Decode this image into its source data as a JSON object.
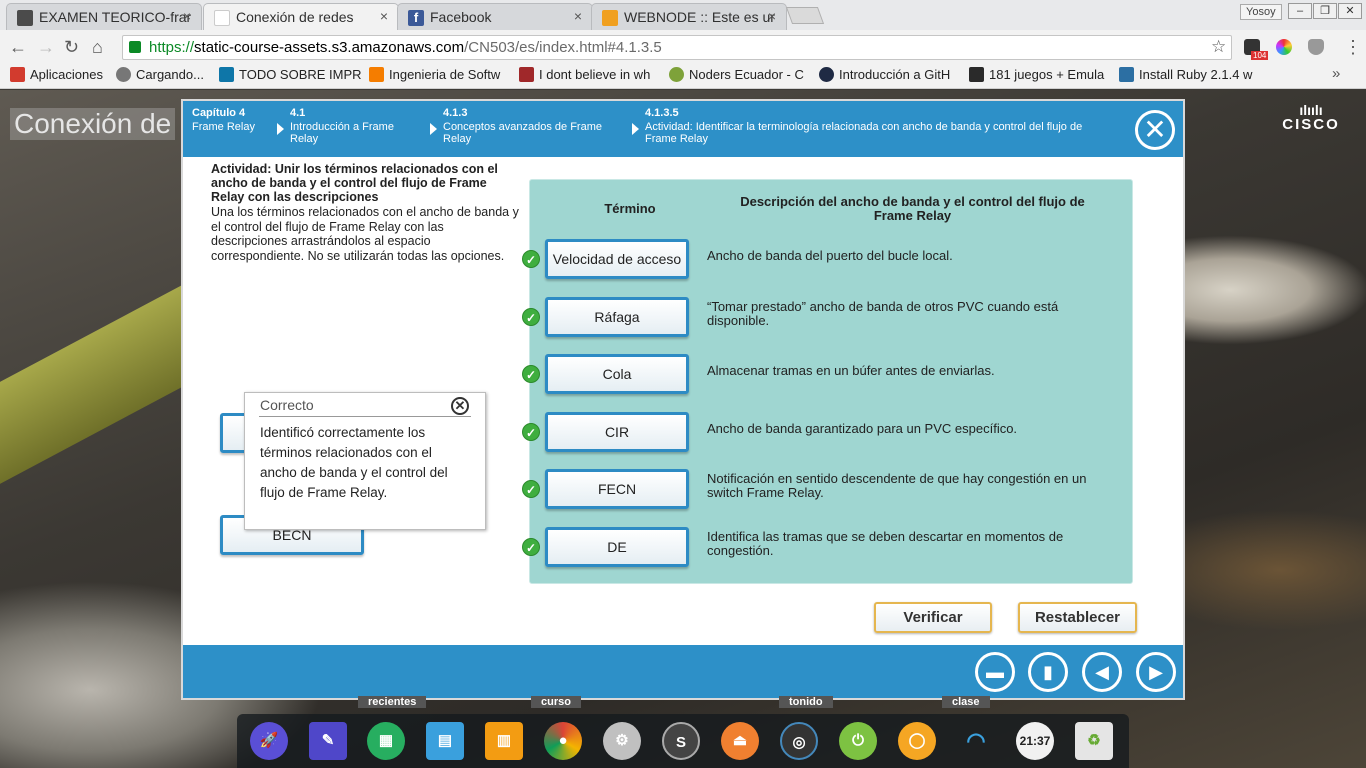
{
  "browser": {
    "tabs": [
      {
        "label": "EXAMEN TEORICO-frar",
        "close": "×",
        "favicon_color": "#4b4b4b"
      },
      {
        "label": "Conexión de redes",
        "close": "×",
        "favicon_color": "#ffffff"
      },
      {
        "label": "Facebook",
        "close": "×",
        "favicon_color": "#3b5998"
      },
      {
        "label": "WEBNODE :: Este es ur",
        "close": "×",
        "favicon_color": "#f0a020"
      }
    ],
    "user": "Yosoy",
    "url": {
      "scheme": "https://",
      "host": "static-course-assets.s3.amazonaws.com",
      "path": "/CN503/es/index.html#4.1.3.5"
    },
    "extension_badge": "104",
    "bookmarks": [
      {
        "label": "Aplicaciones",
        "color": "#d23b2e"
      },
      {
        "label": "Cargando...",
        "color": "#777777"
      },
      {
        "label": "TODO SOBRE IMPR",
        "color": "#0e76a8"
      },
      {
        "label": "Ingenieria de Softw",
        "color": "#f57d00"
      },
      {
        "label": "I dont believe in wh",
        "color": "#a0282a"
      },
      {
        "label": "Noders Ecuador - C",
        "color": "#7ea23a"
      },
      {
        "label": "Introducción a GitH",
        "color": "#1f2a44"
      },
      {
        "label": "181 juegos + Emula",
        "color": "#2a2a2a"
      },
      {
        "label": "Install Ruby 2.1.4 w",
        "color": "#2c6fa3"
      }
    ],
    "bookmarks_more": "»"
  },
  "background": {
    "title": "Conexión de"
  },
  "course": {
    "breadcrumbs": [
      {
        "num": "Capítulo 4",
        "text": "Frame Relay"
      },
      {
        "num": "4.1",
        "text": "Introducción a Frame Relay"
      },
      {
        "num": "4.1.3",
        "text": "Conceptos avanzados de Frame Relay"
      },
      {
        "num": "4.1.3.5",
        "text": "Actividad: Identificar la terminología relacionada con ancho de banda y control del flujo de Frame Relay"
      }
    ],
    "logo": "CISCO",
    "activity_title": "Actividad: Unir los términos relacionados con el ancho de banda y el control del flujo de Frame Relay con las descripciones",
    "instructions": "Una los términos relacionados con el ancho de banda y el control del flujo de Frame Relay con las descripciones arrastrándolos al espacio correspondiente. No se utilizarán todas las opciones.",
    "col_term": "Término",
    "col_desc": "Descripción del ancho de banda y el control del flujo de Frame Relay",
    "rows": [
      {
        "term": "Velocidad de acceso",
        "desc": "Ancho de banda del puerto del bucle local."
      },
      {
        "term": "Ráfaga",
        "desc": "“Tomar prestado” ancho de banda de otros PVC cuando está disponible."
      },
      {
        "term": "Cola",
        "desc": "Almacenar tramas en un búfer antes de enviarlas."
      },
      {
        "term": "CIR",
        "desc": "Ancho de banda garantizado para un PVC específico."
      },
      {
        "term": "FECN",
        "desc": "Notificación en sentido descendente de que hay congestión en un switch Frame Relay."
      },
      {
        "term": "DE",
        "desc": "Identifica las tramas que se deben descartar en momentos de congestión."
      }
    ],
    "spare_terms": [
      "",
      "BECN"
    ],
    "feedback": {
      "title": "Correcto",
      "body": "Identificó correctamente los términos relacionados con el ancho de banda y el control del flujo de Frame Relay."
    },
    "verify_label": "Verificar",
    "reset_label": "Restablecer"
  },
  "dock": {
    "behind_labels": [
      "recientes",
      "curso",
      "tonido",
      "clase"
    ],
    "clock": "21:37"
  }
}
